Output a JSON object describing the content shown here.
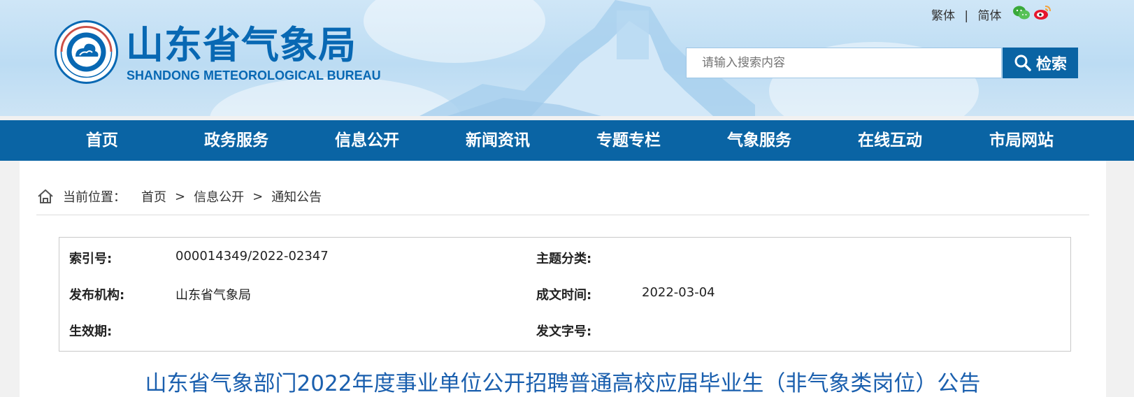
{
  "header": {
    "title": "山东省气象局",
    "subtitle": "SHANDONG METEOROLOGICAL BUREAU",
    "lang": {
      "traditional": "繁体",
      "separator": "|",
      "simplified": "简体"
    },
    "social": [
      {
        "icon": "wechat-icon"
      },
      {
        "icon": "weibo-icon"
      }
    ],
    "search": {
      "placeholder": "请输入搜索内容",
      "button_label": "检索"
    }
  },
  "nav": {
    "items": [
      {
        "label": "首页"
      },
      {
        "label": "政务服务"
      },
      {
        "label": "信息公开"
      },
      {
        "label": "新闻资讯"
      },
      {
        "label": "专题专栏"
      },
      {
        "label": "气象服务"
      },
      {
        "label": "在线互动"
      },
      {
        "label": "市局网站"
      }
    ]
  },
  "breadcrumb": {
    "prefix": "当前位置：",
    "items": [
      "首页",
      "信息公开",
      "通知公告"
    ],
    "separator": ">"
  },
  "meta": {
    "index_label": "索引号:",
    "index_value": "000014349/2022-02347",
    "topic_label": "主题分类:",
    "topic_value": "",
    "publisher_label": "发布机构:",
    "publisher_value": "山东省气象局",
    "date_label": "成文时间:",
    "date_value": "2022-03-04",
    "effective_label": "生效期:",
    "effective_value": "",
    "docnum_label": "发文字号:",
    "docnum_value": ""
  },
  "article": {
    "title": "山东省气象部门2022年度事业单位公开招聘普通高校应届毕业生（非气象类岗位）公告"
  },
  "colors": {
    "brand_blue": "#0a64a4",
    "title_blue": "#1a5fae",
    "logo_blue": "#0868b3"
  }
}
